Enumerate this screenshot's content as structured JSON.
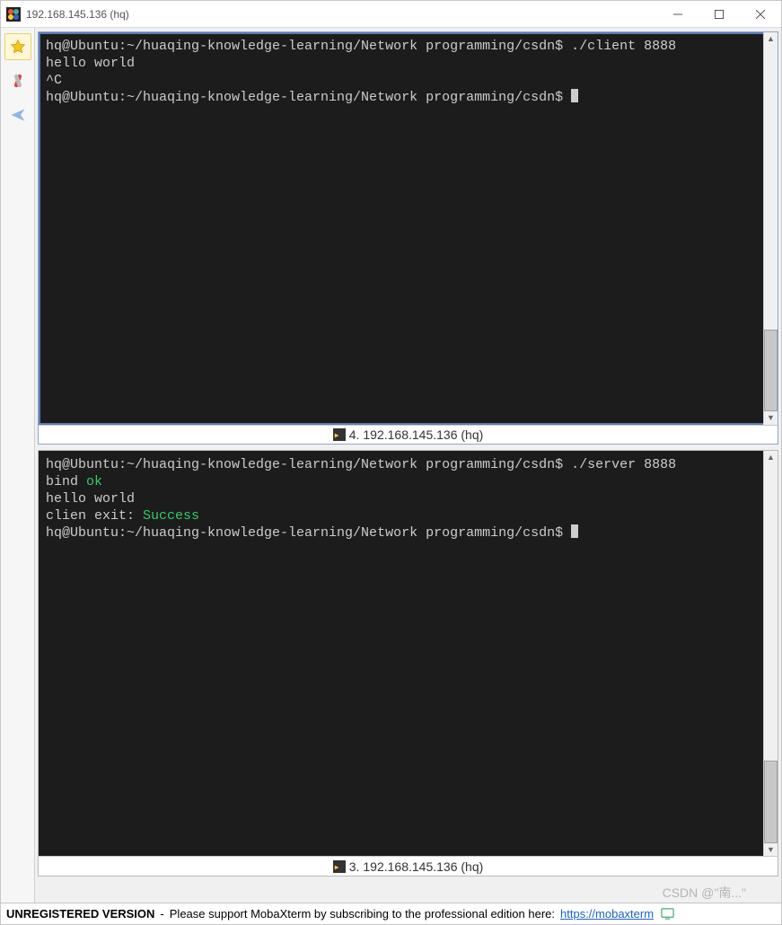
{
  "window": {
    "title": "192.168.145.136 (hq)"
  },
  "sidebar": {
    "items": [
      {
        "name": "star-icon"
      },
      {
        "name": "tool-icon"
      },
      {
        "name": "send-icon"
      }
    ]
  },
  "panes": {
    "top": {
      "title_prefix": "4.",
      "title": "192.168.145.136 (hq)",
      "lines": {
        "l1_prompt": "hq@Ubuntu",
        "l1_path": ":~/huaqing-knowledge-learning/Network programming/csdn$ ",
        "l1_cmd": "./client 8888",
        "l2": "hello world",
        "l3": "^C",
        "l4_prompt": "hq@Ubuntu",
        "l4_path": ":~/huaqing-knowledge-learning/Network programming/csdn$ "
      }
    },
    "bottom": {
      "title_prefix": "3.",
      "title": "192.168.145.136 (hq)",
      "lines": {
        "l1_prompt": "hq@Ubuntu",
        "l1_path": ":~/huaqing-knowledge-learning/Network programming/csdn$ ",
        "l1_cmd": "./server 8888",
        "l2a": "bind ",
        "l2b_ok": "ok",
        "l3": "hello world",
        "l4a": "clien exit: ",
        "l4b_success": "Success",
        "l5_prompt": "hq@Ubuntu",
        "l5_path": ":~/huaqing-knowledge-learning/Network programming/csdn$ "
      }
    }
  },
  "statusbar": {
    "left": "UNREGISTERED VERSION",
    "sep": " - ",
    "mid": "Please support MobaXterm by subscribing to the professional edition here: ",
    "link": "https://mobaxterm"
  },
  "watermark": "CSDN @\"南...\""
}
